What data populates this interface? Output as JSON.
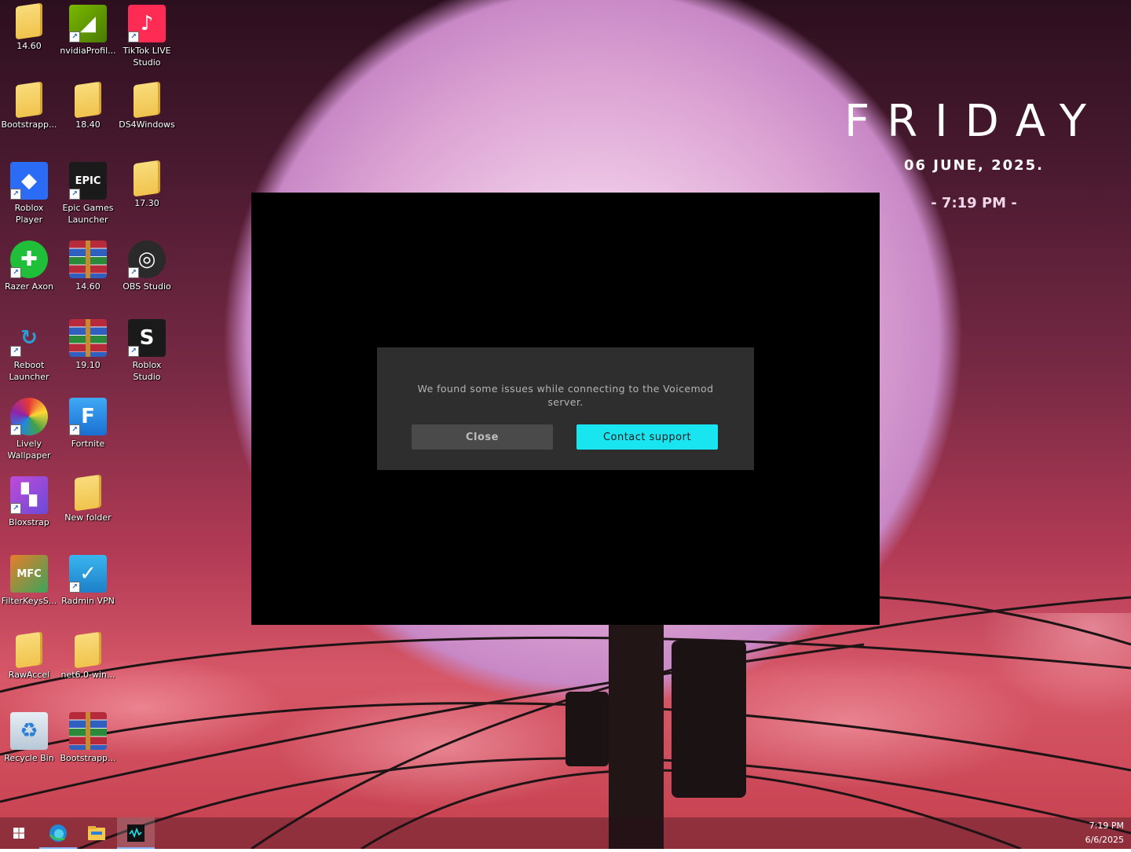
{
  "widget": {
    "day": "FRIDAY",
    "date": "06  JUNE,  2025.",
    "time": "- 7:19 PM -"
  },
  "desktop_icons": [
    {
      "label": "14.60",
      "icon": "folder-icon"
    },
    {
      "label": "nvidiaProfil...",
      "icon": "nvidia-profile-icon"
    },
    {
      "label": "TikTok LIVE Studio",
      "icon": "tiktok-live-studio-icon"
    },
    {
      "label": "Bootstrapp...",
      "icon": "folder-icon"
    },
    {
      "label": "18.40",
      "icon": "folder-icon"
    },
    {
      "label": "DS4Windows",
      "icon": "folder-icon"
    },
    {
      "label": "Roblox Player",
      "icon": "roblox-player-icon"
    },
    {
      "label": "Epic Games Launcher",
      "icon": "epic-games-icon"
    },
    {
      "label": "17.30",
      "icon": "folder-icon"
    },
    {
      "label": "Razer Axon",
      "icon": "razer-axon-icon"
    },
    {
      "label": "14.60",
      "icon": "winrar-archive-icon"
    },
    {
      "label": "OBS Studio",
      "icon": "obs-studio-icon"
    },
    {
      "label": "Reboot Launcher",
      "icon": "reboot-launcher-icon"
    },
    {
      "label": "19.10",
      "icon": "winrar-archive-icon"
    },
    {
      "label": "Roblox Studio",
      "icon": "roblox-studio-icon"
    },
    {
      "label": "Lively Wallpaper",
      "icon": "lively-wallpaper-icon"
    },
    {
      "label": "Fortnite",
      "icon": "fortnite-icon"
    },
    {
      "label": "Bloxstrap",
      "icon": "bloxstrap-icon"
    },
    {
      "label": "New folder",
      "icon": "folder-icon"
    },
    {
      "label": "FilterKeysS...",
      "icon": "filterkeys-icon"
    },
    {
      "label": "Radmin VPN",
      "icon": "radmin-vpn-icon"
    },
    {
      "label": "RawAccel",
      "icon": "folder-icon"
    },
    {
      "label": "net6.0-win...",
      "icon": "folder-icon"
    },
    {
      "label": "Recycle Bin",
      "icon": "recycle-bin-icon"
    },
    {
      "label": "Bootstrapp...",
      "icon": "winrar-archive-icon"
    }
  ],
  "dialog": {
    "message": "We found some issues while connecting to the Voicemod server.",
    "close_label": "Close",
    "contact_label": "Contact support",
    "contact_color": "#19e5f0"
  },
  "taskbar": {
    "items": [
      "start-icon",
      "edge-icon",
      "file-explorer-icon",
      "voicemod-icon"
    ],
    "clock_time": "7:19 PM",
    "clock_date": "6/6/2025"
  }
}
